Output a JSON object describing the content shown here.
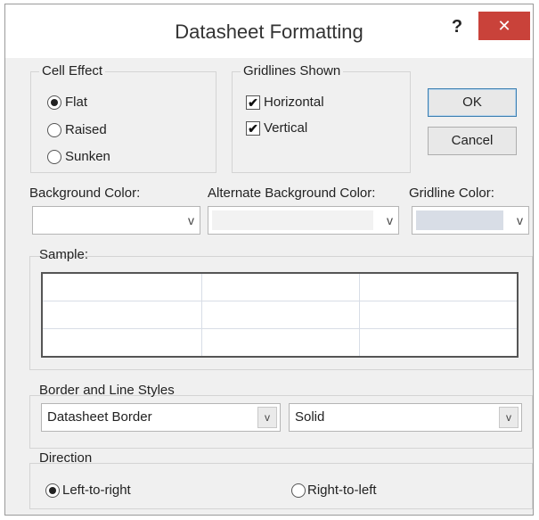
{
  "window": {
    "title": "Datasheet Formatting",
    "help_label": "?",
    "close_label": "✕"
  },
  "cell_effect": {
    "label": "Cell Effect",
    "options": [
      {
        "label": "Flat",
        "selected": true
      },
      {
        "label": "Raised",
        "selected": false
      },
      {
        "label": "Sunken",
        "selected": false
      }
    ]
  },
  "gridlines": {
    "label": "Gridlines Shown",
    "options": [
      {
        "label": "Horizontal",
        "checked": true
      },
      {
        "label": "Vertical",
        "checked": true
      }
    ],
    "check_glyph": "✔"
  },
  "buttons": {
    "ok": "OK",
    "cancel": "Cancel"
  },
  "colors": {
    "background_label": "Background Color:",
    "background_value": "#ffffff",
    "alternate_label": "Alternate Background Color:",
    "alternate_value": "#f2f2f2",
    "gridline_label": "Gridline Color:",
    "gridline_value": "#d8dde6"
  },
  "sample": {
    "label": "Sample:"
  },
  "border_styles": {
    "label": "Border and Line Styles",
    "border_value": "Datasheet Border",
    "line_value": "Solid"
  },
  "direction": {
    "label": "Direction",
    "options": [
      {
        "label": "Left-to-right",
        "selected": true
      },
      {
        "label": "Right-to-left",
        "selected": false
      }
    ]
  },
  "icons": {
    "dropdown_arrow": "⌄",
    "dropdown_glyph": "v"
  },
  "theme": {
    "close_red": "#c9423a",
    "dialog_bg": "#f0f0f0"
  }
}
